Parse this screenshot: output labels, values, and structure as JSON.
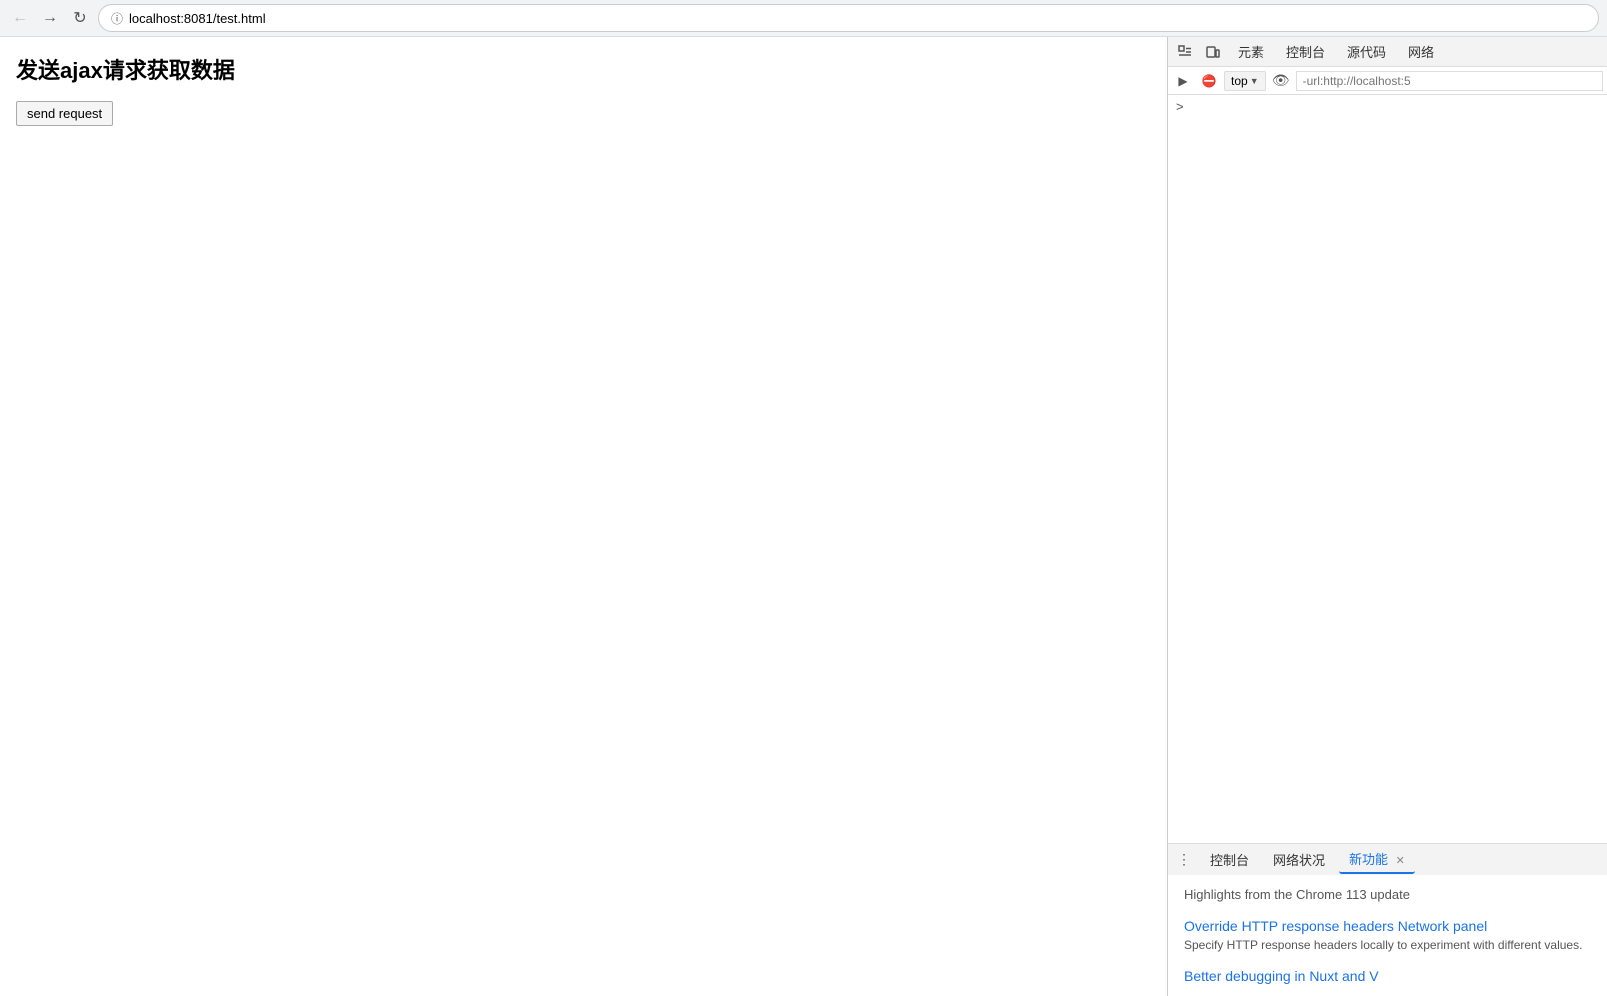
{
  "browser": {
    "url": "localhost:8081/test.html",
    "back_disabled": true,
    "forward_disabled": true
  },
  "page": {
    "title": "发送ajax请求获取数据",
    "send_button_label": "send request"
  },
  "devtools": {
    "tabs": [
      {
        "label": "元素",
        "active": false
      },
      {
        "label": "控制台",
        "active": false
      },
      {
        "label": "源代码",
        "active": false
      },
      {
        "label": "网络",
        "active": false
      }
    ],
    "filter_bar": {
      "top_label": "top",
      "filter_placeholder": "-url:http://localhost:5"
    },
    "bottom_tabs": [
      {
        "label": "控制台",
        "active": false,
        "closable": false
      },
      {
        "label": "网络状况",
        "active": false,
        "closable": false
      },
      {
        "label": "新功能",
        "active": true,
        "closable": true
      }
    ],
    "features": {
      "highlight_text": "Highlights from the Chrome 113 update",
      "items": [
        {
          "link": "Override HTTP response headers Network panel",
          "description": "Specify HTTP response headers locally to\nexperiment with different values."
        },
        {
          "link": "Better debugging in Nuxt and V",
          "description": ""
        }
      ]
    }
  }
}
